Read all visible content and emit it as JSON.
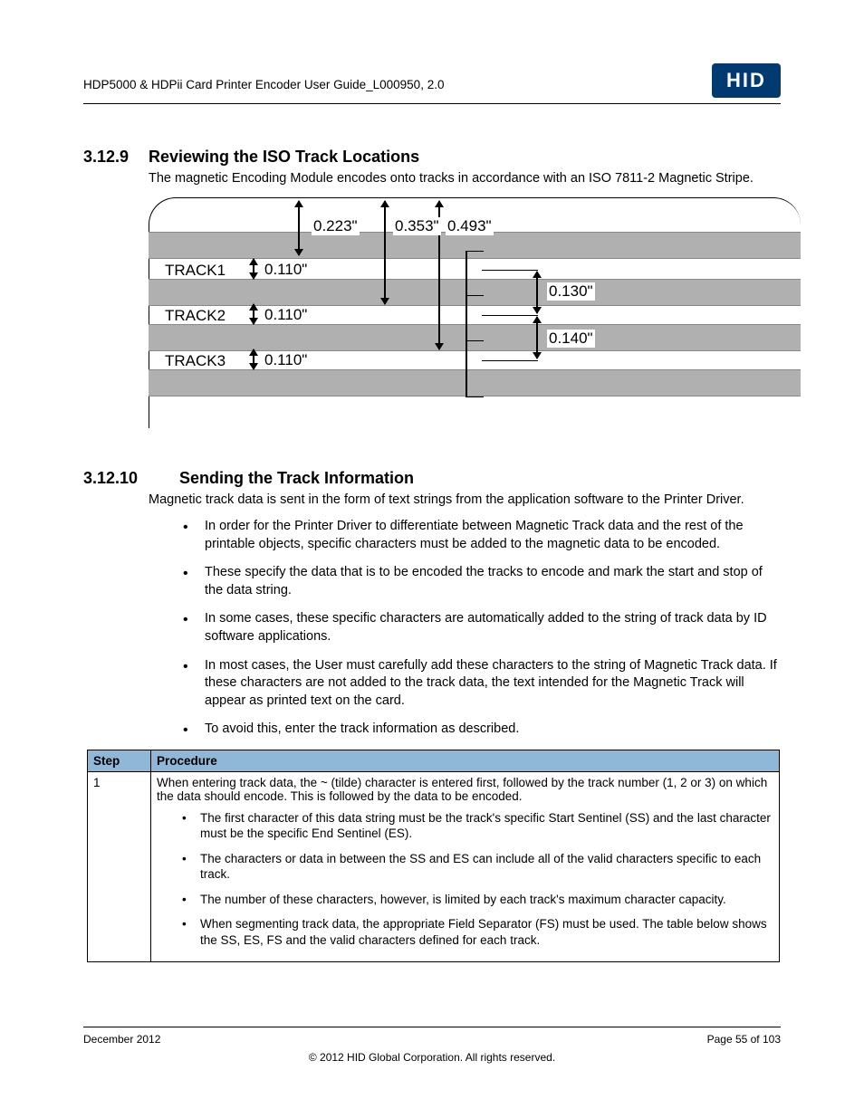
{
  "header": {
    "docTitle": "HDP5000 & HDPii Card Printer Encoder User Guide_L000950, 2.0",
    "logoText": "HID"
  },
  "section1": {
    "number": "3.12.9",
    "title": "Reviewing the ISO Track Locations",
    "intro": "The magnetic Encoding Module encodes onto tracks in accordance with an ISO 7811-2 Magnetic Stripe."
  },
  "diagram": {
    "top1": "0.223\"",
    "top2": "0.353\"",
    "top3": "0.493\"",
    "track1": "TRACK1",
    "track2": "TRACK2",
    "track3": "TRACK3",
    "w1": "0.110\"",
    "w2": "0.110\"",
    "w3": "0.110\"",
    "gap1": "0.130\"",
    "gap2": "0.140\""
  },
  "section2": {
    "number": "3.12.10",
    "title": "Sending the Track Information",
    "intro": "Magnetic track data is sent in the form of text strings from the application software to the Printer Driver.",
    "bullets": [
      "In order for the Printer Driver to differentiate between Magnetic Track data and the rest of the printable objects, specific characters must be added to the magnetic data to be encoded.",
      "These specify the data that is to be encoded the tracks to encode and mark the start and stop of the data string.",
      "In some cases, these specific characters are automatically added to the string of track data by ID software applications.",
      "In most cases, the User must carefully add these characters to the string of Magnetic Track data. If these characters are not added to the track data, the text intended for the Magnetic Track will appear as printed text on the card.",
      "To avoid this, enter the track information as described."
    ]
  },
  "table": {
    "h1": "Step",
    "h2": "Procedure",
    "row1": {
      "step": "1",
      "intro": "When entering track data, the ~ (tilde) character is entered first, followed by the track number (1, 2 or 3) on which the data should encode. This is followed by the data to be encoded.",
      "bullets": [
        "The first character of this data string must be the track's specific Start Sentinel (SS) and the last character must be the specific End Sentinel (ES).",
        "The characters or data in between the SS and ES can include all of the valid characters specific to each track.",
        "The number of these characters, however, is limited by each track's maximum character capacity.",
        "When segmenting track data, the appropriate Field Separator (FS) must be used. The table below shows the SS, ES, FS and the valid characters defined for each track."
      ]
    }
  },
  "footer": {
    "date": "December 2012",
    "page": "Page 55 of 103",
    "copyright": "© 2012 HID Global Corporation. All rights reserved."
  }
}
